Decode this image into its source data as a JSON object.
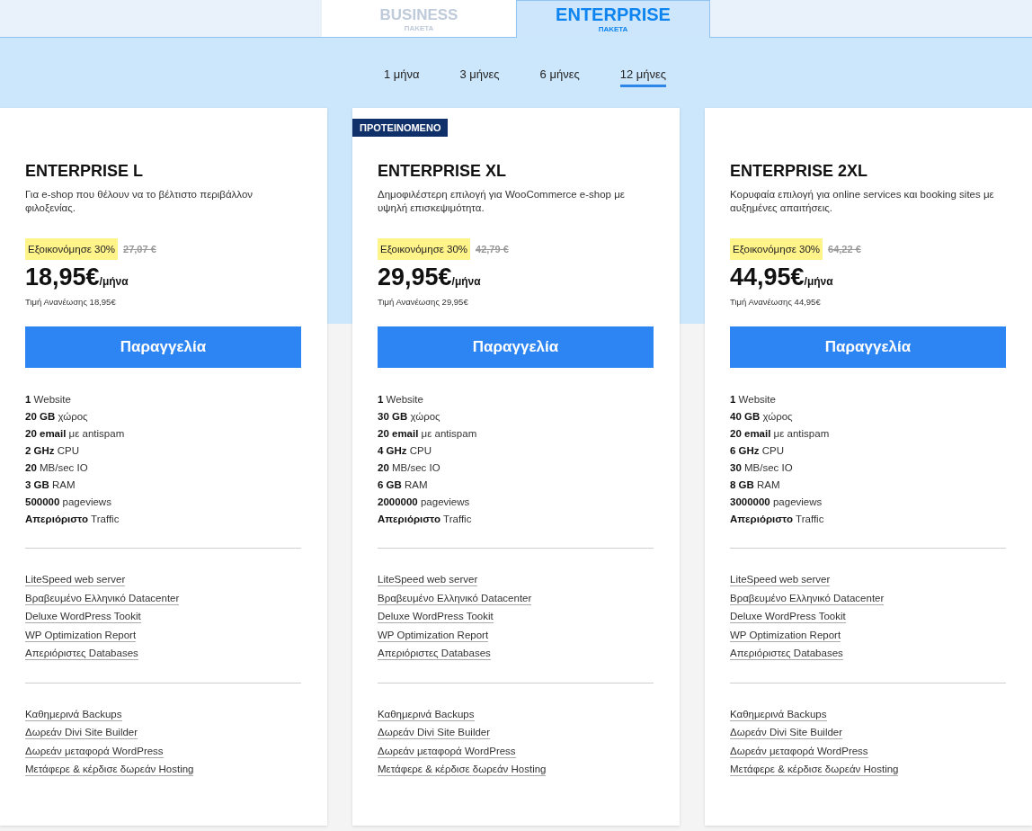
{
  "package_tabs": [
    {
      "title": "BUSINESS",
      "subtitle": "ΠΑΚΕΤΑ",
      "selected": false
    },
    {
      "title": "ENTERPRISE",
      "subtitle": "ΠΑΚΕΤΑ",
      "selected": true
    }
  ],
  "periods": [
    {
      "label": "1 μήνα",
      "selected": false
    },
    {
      "label": "3 μήνες",
      "selected": false
    },
    {
      "label": "6 μήνες",
      "selected": false
    },
    {
      "label": "12 μήνες",
      "selected": true
    }
  ],
  "plans": [
    {
      "name": "ENTERPRISE L",
      "description": "Για e-shop που θέλουν να το βέλτιστο περιβάλλον φιλοξενίας.",
      "discount": "Εξοικονόμησε 30%",
      "old_price": "27,07 €",
      "price": "18,95€",
      "per": "/μήνα",
      "renewal": "Τιμή Ανανέωσης 18,95€",
      "button": "Παραγγελία",
      "features": [
        "**1** Website",
        "**20 GB** χώρος",
        "**20 email** με antispam",
        "**2 GHz** CPU",
        "**20** MB/sec IO",
        "**3 GB** RAM",
        "**500000** pageviews",
        "**Απεριόριστο** Traffic"
      ],
      "extras": [
        "LiteSpeed web server",
        "Βραβευμένο Ελληνικό Datacenter",
        "Deluxe WordPress Tookit",
        "WP Optimization Report",
        "Απεριόριστες Databases"
      ],
      "bonuses": [
        "Καθημερινά Backups",
        "Δωρεάν Divi Site Builder",
        "Δωρεάν μεταφορά WordPress",
        "Μετάφερε & κέρδισε δωρεάν Hosting"
      ]
    },
    {
      "badge": "ΠΡΟΤΕΙΝΟΜΕΝΟ",
      "name": "ENTERPRISE XL",
      "description": "Δημοφιλέστερη επιλογή για WooCommerce e-shop με υψηλή επισκεψιμότητα.",
      "discount": "Εξοικονόμησε 30%",
      "old_price": "42,79 €",
      "price": "29,95€",
      "per": "/μήνα",
      "renewal": "Τιμή Ανανέωσης 29,95€",
      "button": "Παραγγελία",
      "features": [
        "**1** Website",
        "**30 GB** χώρος",
        "**20 email** με antispam",
        "**4 GHz** CPU",
        "**20** MB/sec IO",
        "**6 GB** RAM",
        "**2000000** pageviews",
        "**Απεριόριστο** Traffic"
      ],
      "extras": [
        "LiteSpeed web server",
        "Βραβευμένο Ελληνικό Datacenter",
        "Deluxe WordPress Tookit",
        "WP Optimization Report",
        "Απεριόριστες Databases"
      ],
      "bonuses": [
        "Καθημερινά Backups",
        "Δωρεάν Divi Site Builder",
        "Δωρεάν μεταφορά WordPress",
        "Μετάφερε & κέρδισε δωρεάν Hosting"
      ]
    },
    {
      "name": "ENTERPRISE 2XL",
      "description": "Κορυφαία επιλογή για online services και booking sites με αυξημένες απαιτήσεις.",
      "discount": "Εξοικονόμησε 30%",
      "old_price": "64,22 €",
      "price": "44,95€",
      "per": "/μήνα",
      "renewal": "Τιμή Ανανέωσης 44,95€",
      "button": "Παραγγελία",
      "features": [
        "**1** Website",
        "**40 GB** χώρος",
        "**20 email** με antispam",
        "**6 GHz** CPU",
        "**30** MB/sec IO",
        "**8 GB** RAM",
        "**3000000** pageviews",
        "**Απεριόριστο** Traffic"
      ],
      "extras": [
        "LiteSpeed web server",
        "Βραβευμένο Ελληνικό Datacenter",
        "Deluxe WordPress Tookit",
        "WP Optimization Report",
        "Απεριόριστες Databases"
      ],
      "bonuses": [
        "Καθημερινά Backups",
        "Δωρεάν Divi Site Builder",
        "Δωρεάν μεταφορά WordPress",
        "Μετάφερε & κέρδισε δωρεάν Hosting"
      ]
    }
  ]
}
